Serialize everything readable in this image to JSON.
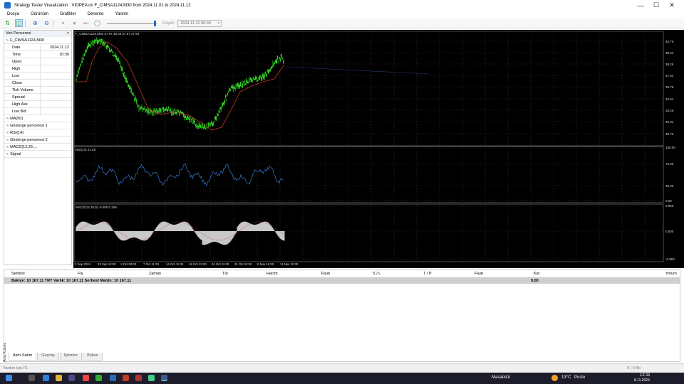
{
  "window": {
    "title": "Strategy Tester Visualization : VIOPEA on F_CIMSA1124,M30 from 2024.11.01 to 2024.11.12"
  },
  "menu": [
    "Dosya",
    "Görünüm",
    "Grafikler",
    "Deneme",
    "Yardım"
  ],
  "toolbar": {
    "scroll_label": "Kaydır",
    "date_value": "2024.11.12 00:00"
  },
  "data_window": {
    "title": "Veri Penceresi",
    "symbol": "F_CIMSA1124,M30",
    "rows": [
      {
        "k": "Date",
        "v": "2024.11.12"
      },
      {
        "k": "Time",
        "v": "10:30"
      },
      {
        "k": "Open",
        "v": ""
      },
      {
        "k": "High",
        "v": ""
      },
      {
        "k": "Low",
        "v": ""
      },
      {
        "k": "Close",
        "v": ""
      },
      {
        "k": "Tick Volume",
        "v": ""
      },
      {
        "k": "Spread",
        "v": ""
      },
      {
        "k": "High Ask",
        "v": ""
      },
      {
        "k": "Low Bid",
        "v": ""
      }
    ],
    "groups": [
      "MA(50)",
      "Gösterge penceresi 1",
      "RSI(14)",
      "Gösterge penceresi 2",
      "MACD(12,26,...",
      "Signal"
    ]
  },
  "chart": {
    "main_label": "F_CIMSA1124,M30  37.97 38.33 37.87 37.94",
    "rsi_label": "RSI(14) 41.28",
    "macd_label": "MACD(12,26,9) -0.005 0.159",
    "price_ticks": [
      "40.76",
      "39.51",
      "38.26",
      "37.01",
      "35.76",
      "34.51",
      "33.26",
      "32.01",
      "30.76"
    ],
    "rsi_ticks": [
      "100.00",
      "70.00",
      "30.00",
      "0.00"
    ],
    "macd_ticks": [
      "0.958",
      "0.000",
      "-0.963"
    ],
    "time_ticks": [
      "2 Sep 2024",
      "23 Sep 12:00",
      "1 Oct 00:00",
      "7 Oct 11:30",
      "14 Oct 11:30",
      "18 Oct 13:30",
      "24 Oct 11:30",
      "31 Oct 12:30",
      "5 Nov 16:30",
      "11 Nov 10:30"
    ],
    "colors": {
      "price": "#39e62a",
      "ma": "#c0392b",
      "rsi": "#3a78c9",
      "macd": "#c8c8c8",
      "grid": "#3a3a3a"
    }
  },
  "terminal": {
    "columns": [
      "Sembol",
      "Fiş",
      "Zaman",
      "Tür",
      "Hacim",
      "Fiyat",
      "S / L",
      "T / P",
      "Fiyat",
      "Kar",
      "Yorum"
    ],
    "balance_text": "Bakiye: 10 167.11 TRY  Varlık: 10 167.11  Serbest Marjin: 10 167.11",
    "profit": "0.00",
    "side_label": "Araç Kutusu",
    "tabs": [
      "Alım-Satım",
      "Geçmiş",
      "İşlemler",
      "Bülten"
    ]
  },
  "status": {
    "left": "Yardım için F1",
    "right": "0 / 0 Kb"
  },
  "taskbar": {
    "desktop": "Masaüstü",
    "weather_temp": "13°C",
    "weather_text": "Puslu",
    "time": "12:11",
    "date": "8.11.2024"
  }
}
